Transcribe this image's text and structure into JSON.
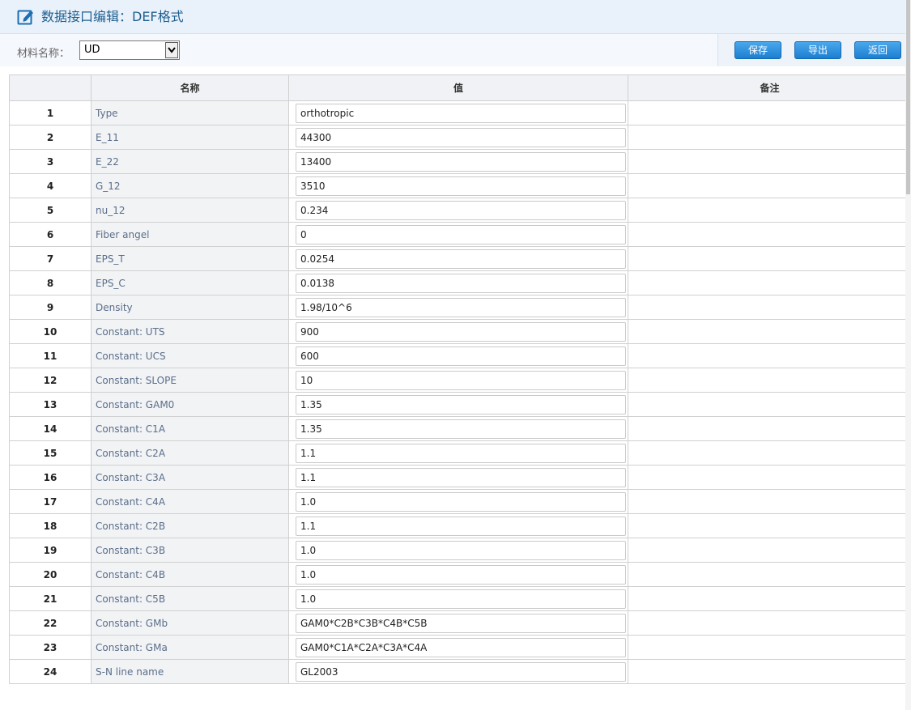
{
  "header": {
    "title": "数据接口编辑：DEF格式"
  },
  "toolbar": {
    "material_label": "材料名称：",
    "material_value": "UD",
    "save_label": "保存",
    "export_label": "导出",
    "back_label": "返回"
  },
  "table": {
    "columns": [
      "",
      "名称",
      "值",
      "备注"
    ],
    "rows": [
      {
        "num": "1",
        "name": "Type",
        "value": "orthotropic",
        "note": ""
      },
      {
        "num": "2",
        "name": "E_11",
        "value": "44300",
        "note": ""
      },
      {
        "num": "3",
        "name": "E_22",
        "value": "13400",
        "note": ""
      },
      {
        "num": "4",
        "name": "G_12",
        "value": "3510",
        "note": ""
      },
      {
        "num": "5",
        "name": "nu_12",
        "value": "0.234",
        "note": ""
      },
      {
        "num": "6",
        "name": "Fiber angel",
        "value": "0",
        "note": ""
      },
      {
        "num": "7",
        "name": "EPS_T",
        "value": "0.0254",
        "note": ""
      },
      {
        "num": "8",
        "name": "EPS_C",
        "value": "0.0138",
        "note": ""
      },
      {
        "num": "9",
        "name": "Density",
        "value": "1.98/10^6",
        "note": ""
      },
      {
        "num": "10",
        "name": "Constant: UTS",
        "value": "900",
        "note": ""
      },
      {
        "num": "11",
        "name": "Constant: UCS",
        "value": "600",
        "note": ""
      },
      {
        "num": "12",
        "name": "Constant: SLOPE",
        "value": "10",
        "note": ""
      },
      {
        "num": "13",
        "name": "Constant: GAM0",
        "value": "1.35",
        "note": ""
      },
      {
        "num": "14",
        "name": "Constant: C1A",
        "value": "1.35",
        "note": ""
      },
      {
        "num": "15",
        "name": "Constant: C2A",
        "value": "1.1",
        "note": ""
      },
      {
        "num": "16",
        "name": "Constant: C3A",
        "value": "1.1",
        "note": ""
      },
      {
        "num": "17",
        "name": "Constant: C4A",
        "value": "1.0",
        "note": ""
      },
      {
        "num": "18",
        "name": "Constant: C2B",
        "value": "1.1",
        "note": ""
      },
      {
        "num": "19",
        "name": "Constant: C3B",
        "value": "1.0",
        "note": ""
      },
      {
        "num": "20",
        "name": "Constant: C4B",
        "value": "1.0",
        "note": ""
      },
      {
        "num": "21",
        "name": "Constant: C5B",
        "value": "1.0",
        "note": ""
      },
      {
        "num": "22",
        "name": "Constant: GMb",
        "value": "GAM0*C2B*C3B*C4B*C5B",
        "note": ""
      },
      {
        "num": "23",
        "name": "Constant: GMa",
        "value": "GAM0*C1A*C2A*C3A*C4A",
        "note": ""
      },
      {
        "num": "24",
        "name": "S-N line name",
        "value": "GL2003",
        "note": ""
      }
    ]
  },
  "icons": {
    "header_icon": "edit-icon",
    "select_arrow": "chevron-down-icon"
  },
  "colors": {
    "accent": "#1b7fd1",
    "title": "#1f5f8f",
    "header_bg": "#e9f1fb"
  }
}
